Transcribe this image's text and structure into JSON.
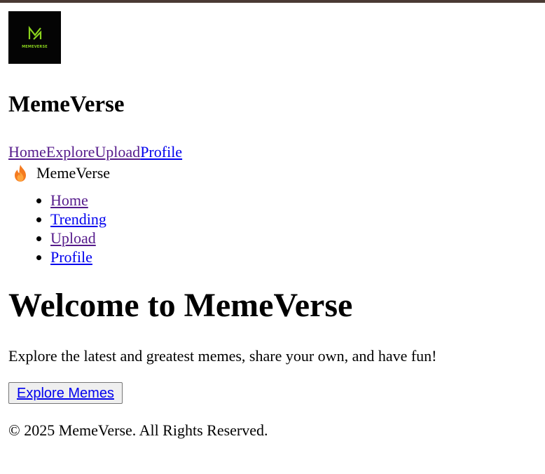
{
  "logo": {
    "text": "MEMEVERSE"
  },
  "site_title": "MemeVerse",
  "top_nav": [
    {
      "label": "Home"
    },
    {
      "label": "Explore"
    },
    {
      "label": "Upload"
    },
    {
      "label": "Profile"
    }
  ],
  "brand": {
    "icon": "fire-icon",
    "name": "MemeVerse"
  },
  "menu": [
    {
      "label": "Home"
    },
    {
      "label": "Trending"
    },
    {
      "label": "Upload"
    },
    {
      "label": "Profile"
    }
  ],
  "hero": {
    "title": "Welcome to MemeVerse",
    "description": "Explore the latest and greatest memes, share your own, and have fun!",
    "button_label": "Explore Memes"
  },
  "footer": {
    "text": "© 2025 MemeVerse. All Rights Reserved."
  },
  "colors": {
    "top_border": "#4a3a34",
    "link": "#0000ee",
    "visited_link": "#551a8b",
    "logo_bg": "#040404",
    "logo_accent": "#8ad31d"
  }
}
